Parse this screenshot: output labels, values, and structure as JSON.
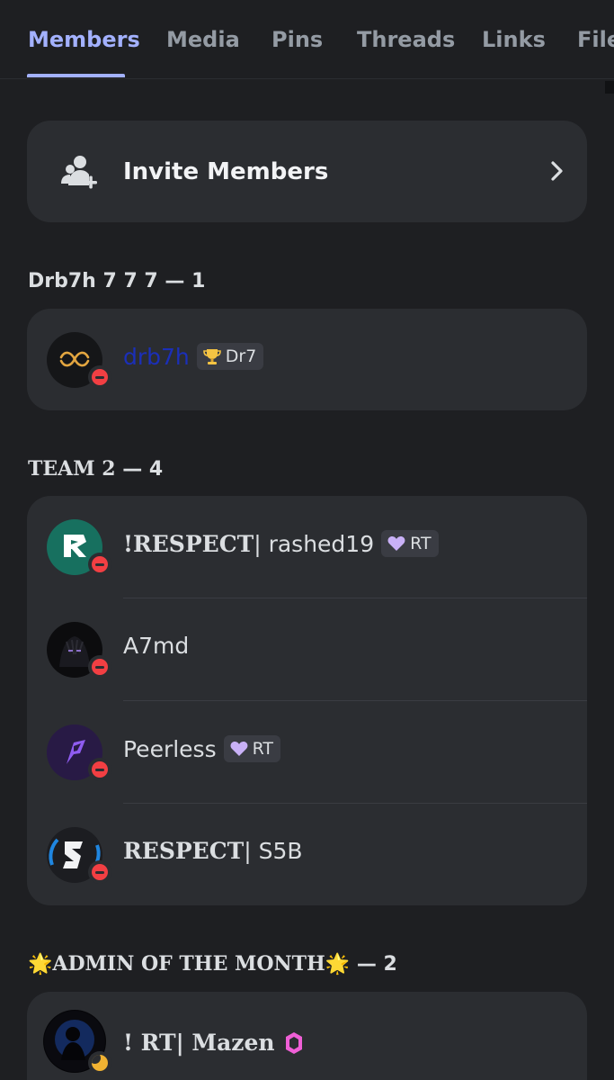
{
  "tabs": [
    {
      "label": "Members",
      "active": true
    },
    {
      "label": "Media",
      "active": false
    },
    {
      "label": "Pins",
      "active": false
    },
    {
      "label": "Threads",
      "active": false
    },
    {
      "label": "Links",
      "active": false
    },
    {
      "label": "File",
      "active": false
    }
  ],
  "invite": {
    "label": "Invite Members",
    "icon": "add-user-icon",
    "chevron": "chevron-right-icon"
  },
  "sections": [
    {
      "title_prefix": "",
      "title": "Drb7h 7 7 7",
      "title_suffix": "",
      "count": "1",
      "count_sep": " — ",
      "members": [
        {
          "name": "drb7h",
          "tag_label": "Dr7",
          "tag_icon": "trophy-icon",
          "status": "dnd",
          "name_color": "#1b2fb8"
        }
      ]
    },
    {
      "title_prefix": "",
      "title": "TEAM 2",
      "title_suffix": "",
      "count": "4",
      "count_sep": " — ",
      "members": [
        {
          "name_styled": "!RESPECT",
          "name": "| rashed19",
          "tag_label": "RT",
          "tag_icon": "purple-heart-icon",
          "status": "dnd"
        },
        {
          "name": "A7md",
          "status": "dnd"
        },
        {
          "name": "Peerless",
          "tag_label": "RT",
          "tag_icon": "purple-heart-icon",
          "status": "dnd"
        },
        {
          "name_styled": "RESPECT",
          "name": " | S5B",
          "status": "dnd"
        }
      ]
    },
    {
      "title_prefix": "🌟",
      "title": "ADMIN OF THE MONTH",
      "title_suffix": "🌟",
      "count": "2",
      "count_sep": " — ",
      "members": [
        {
          "name_styled": "!  RT",
          "name": " | Mazen",
          "badge_icon": "pink-gem-icon",
          "status": "idle"
        }
      ]
    }
  ],
  "colors": {
    "accent": "#a3b1ff",
    "background": "#1e1f22",
    "card": "#2b2d31",
    "dnd": "#f23f43",
    "idle": "#f0b232"
  }
}
